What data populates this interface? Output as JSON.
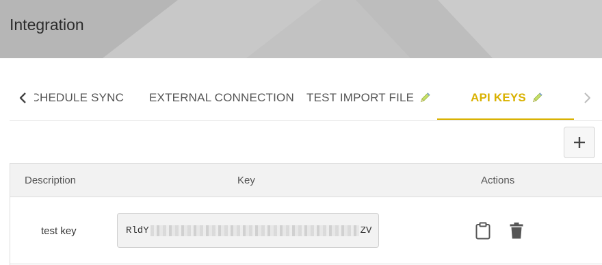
{
  "header": {
    "title": "Integration"
  },
  "tabs": {
    "items": [
      {
        "label": "SCHEDULE SYNC",
        "has_icon": false
      },
      {
        "label": "EXTERNAL CONNECTION",
        "has_icon": false
      },
      {
        "label": "TEST IMPORT FILE",
        "has_icon": true,
        "icon": "pencil-icon"
      },
      {
        "label": "API KEYS",
        "has_icon": true,
        "icon": "pencil-icon",
        "active": true
      }
    ],
    "active_color": "#d9b100",
    "scroll_left_icon": "chevron-left-icon",
    "scroll_right_icon": "chevron-right-icon"
  },
  "toolbar": {
    "add_icon": "plus-icon"
  },
  "table": {
    "columns": [
      "Description",
      "Key",
      "Actions"
    ],
    "rows": [
      {
        "description": "test key",
        "key_prefix": "RldY",
        "key_suffix": "ZV",
        "actions": [
          "clipboard-icon",
          "trash-icon"
        ]
      }
    ]
  }
}
